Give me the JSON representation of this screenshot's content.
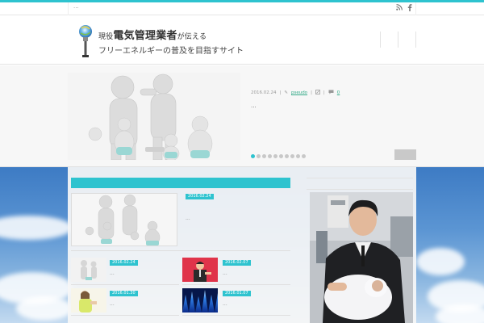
{
  "topbar": {
    "dots": "...",
    "icons": [
      "rss-icon",
      "facebook-icon"
    ]
  },
  "header": {
    "brand_prefix": "現役",
    "brand_main": "電気管理業者",
    "brand_suffix": "が伝える",
    "tagline": "フリーエネルギーの普及を目指すサイト"
  },
  "slider": {
    "date": "2016.02.24",
    "author": "pseudo",
    "comments": "0",
    "title": "...",
    "dot_count": 10,
    "active_dot": 0
  },
  "main": {
    "featured": {
      "date": "2016.02.24",
      "excerpt": "..."
    },
    "grid": [
      {
        "date": "2016.02.24",
        "excerpt": "..."
      },
      {
        "date": "2016.02.07",
        "excerpt": "..."
      },
      {
        "date": "2016.01.30",
        "excerpt": "..."
      },
      {
        "date": "2016.01.07",
        "excerpt": "..."
      }
    ]
  },
  "colors": {
    "accent": "#2ec3cf",
    "sky": "#5b95d3"
  }
}
